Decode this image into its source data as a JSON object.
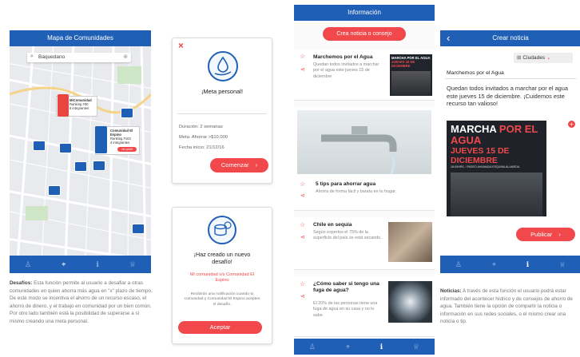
{
  "screen1": {
    "title": "Mapa de Comunidades",
    "search_value": "Baquedano",
    "popup1": {
      "title": "MiComunidad",
      "lines": [
        "Ranking #30",
        "8 integrantes"
      ]
    },
    "popup2": {
      "title": "Comunidad El Espino",
      "lines": [
        "Ranking #104",
        "4 integrantes"
      ],
      "button": "ver perfil"
    },
    "caption_bold": "Desafíos:",
    "caption": " Esta función permite al usuario a desafiar a otras comunidades en quien ahorra más agua en \"x\" plazo de tiempo. De este modo se incentiva el ahorro de un recurso escaso, el ahorro de dinero, y el trabajo en comunidad por un bien común. Por otro lado también está la posibilidad de superarse a sí mismo creando una meta personal."
  },
  "card1": {
    "close": "×",
    "title": "¡Meta personal!",
    "rows": [
      "Duración: 2 semanas",
      "Meta: Ahorrar >$10.000",
      "Fecha inicio: 21/12/16"
    ],
    "button": "Comenzar"
  },
  "card2": {
    "title": "¡Haz creado un nuevo desafío!",
    "vs": "Mi comunidad v/s Comunidad El Espino",
    "text": "Recibirán una notificación cuando tu comunidad y Comunidad El Espino acepten el desafío.",
    "button": "Aceptar"
  },
  "screen3": {
    "title": "Información",
    "create_button": "Crea noticia o consejo",
    "items": [
      {
        "title": "Marchemos por el Agua",
        "desc": "Quedan todos invitados a marchar por el agua este jueves 15 de diciembre"
      },
      {
        "title": "5 tips para ahorrar agua",
        "desc": "Ahorra de forma fácil y barata en tu hogar."
      },
      {
        "title": "Chile en sequía",
        "desc": "Según expertos el 75% de la superficie del país se está secando."
      },
      {
        "title": "¿Cómo saber si tengo una fuga de agua?",
        "desc": "El 20% de las personas tiene una fuga de agua en su casa y no lo sabe."
      }
    ],
    "poster_lines": [
      "MARCHA POR EL AGUA",
      "JUEVES 15 DE DICIEMBRE"
    ]
  },
  "screen4": {
    "back": "‹",
    "title": "Crear noticia",
    "city_button": "Ciudades",
    "news_title": "Marchemos por el Agua",
    "body": "Quedan todos invitados a marchar por el agua este jueves 15 de diciembre. ¡Cuidemos este recurso tan valioso!",
    "poster_l1a": "MARCHA",
    "poster_l1b": "POR EL AGUA",
    "poster_l2": "JUEVES 15 DE DICIEMBRE",
    "poster_l3": "18:00HRS. / PASEO AHUMADA ESQUINA ALAMEDA",
    "publish": "Publicar",
    "caption_bold": "Noticias:",
    "caption": " A través de esta función el usuario podrá estar informado del acontecer hídrico y de consejos de ahorro de agua. También tiene la opción de compartir la noticia o información en sus redes sociales, o el mismo crear una noticia o tip."
  }
}
